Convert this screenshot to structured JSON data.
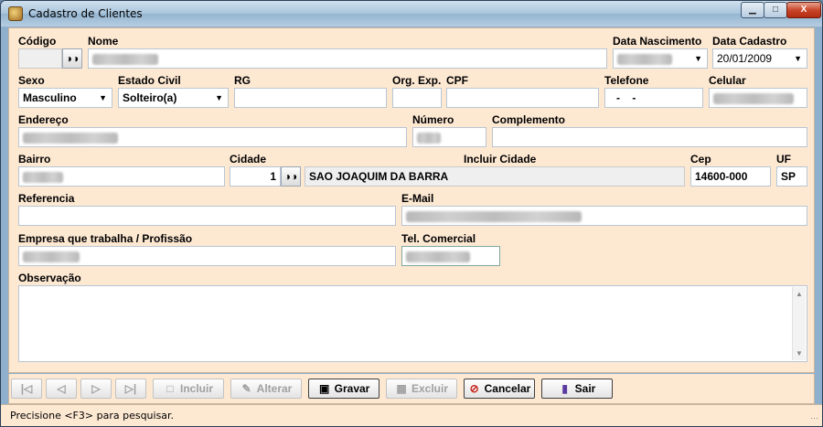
{
  "window": {
    "title": "Cadastro de Clientes",
    "minimize_glyph": "▁",
    "maximize_glyph": "□",
    "close_glyph": "X"
  },
  "form": {
    "codigo": {
      "label": "Código",
      "value": ""
    },
    "nome": {
      "label": "Nome",
      "value": ""
    },
    "data_nascimento": {
      "label": "Data Nascimento",
      "value": ""
    },
    "data_cadastro": {
      "label": "Data Cadastro",
      "value": "20/01/2009"
    },
    "sexo": {
      "label": "Sexo",
      "value": "Masculino"
    },
    "estado_civil": {
      "label": "Estado Civil",
      "value": "Solteiro(a)"
    },
    "rg": {
      "label": "RG",
      "value": ""
    },
    "org_exp": {
      "label": "Org. Exp.",
      "value": ""
    },
    "cpf": {
      "label": "CPF",
      "value": ""
    },
    "telefone": {
      "label": "Telefone",
      "value": "-    -"
    },
    "celular": {
      "label": "Celular",
      "value": ""
    },
    "endereco": {
      "label": "Endereço",
      "value": ""
    },
    "numero": {
      "label": "Número",
      "value": ""
    },
    "complemento": {
      "label": "Complemento",
      "value": ""
    },
    "bairro": {
      "label": "Bairro",
      "value": ""
    },
    "cidade": {
      "label": "Cidade",
      "code": "1",
      "name": "SAO JOAQUIM DA BARRA"
    },
    "incluir_cidade": {
      "label": "Incluir Cidade"
    },
    "cep": {
      "label": "Cep",
      "value": "14600-000"
    },
    "uf": {
      "label": "UF",
      "value": "SP"
    },
    "referencia": {
      "label": "Referencia",
      "value": ""
    },
    "email": {
      "label": "E-Mail",
      "value": ""
    },
    "empresa": {
      "label": "Empresa que trabalha / Profissão",
      "value": ""
    },
    "tel_comercial": {
      "label": "Tel. Comercial",
      "value": ""
    },
    "observacao": {
      "label": "Observação",
      "value": ""
    }
  },
  "toolbar": {
    "first_glyph": "|◁",
    "prev_glyph": "◁",
    "next_glyph": "▷",
    "last_glyph": "▷|",
    "incluir": "Incluir",
    "alterar": "Alterar",
    "gravar": "Gravar",
    "excluir": "Excluir",
    "cancelar": "Cancelar",
    "sair": "Sair"
  },
  "status": {
    "text": "Precisione <F3> para pesquisar."
  },
  "icons": {
    "search": "binoculars-icon",
    "combo": "chevron-down-icon"
  },
  "colors": {
    "form_background": "#fde8d2",
    "titlebar": "#a8c4dc",
    "close_button": "#c8462a"
  }
}
